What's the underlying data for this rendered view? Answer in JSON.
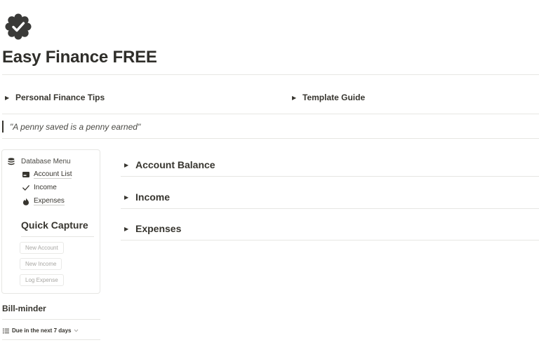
{
  "page": {
    "title": "Easy Finance FREE",
    "icon": "verified-badge-icon"
  },
  "top_toggles": [
    {
      "label": "Personal Finance Tips"
    },
    {
      "label": "Template Guide"
    }
  ],
  "quote": "\"A penny saved is a penny earned\"",
  "database_menu": {
    "heading": "Database Menu",
    "heading_icon": "database-stack-icon",
    "items": [
      {
        "label": "Account List",
        "icon": "card-icon"
      },
      {
        "label": "Income",
        "icon": "checkmark-icon"
      },
      {
        "label": "Expenses",
        "icon": "fire-icon"
      }
    ]
  },
  "quick_capture": {
    "title": "Quick Capture",
    "buttons": [
      {
        "label": "New Account"
      },
      {
        "label": "New Income"
      },
      {
        "label": "Log Expense"
      }
    ]
  },
  "bill_minder": {
    "title": "Bill-minder",
    "view_label": "Due in the next 7 days",
    "view_icon": "list-icon"
  },
  "sections": [
    {
      "label": "Account Balance"
    },
    {
      "label": "Income"
    },
    {
      "label": "Expenses"
    }
  ],
  "colors": {
    "text": "#37352f",
    "divider": "#e6e6e3",
    "muted_button_text": "#a8a7a3"
  }
}
